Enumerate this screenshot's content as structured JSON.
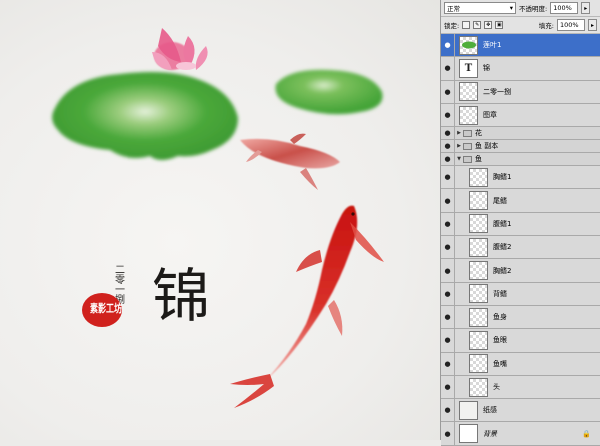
{
  "panel": {
    "blend_mode": "正常",
    "opacity_label": "不透明度:",
    "opacity_value": "100%",
    "lock_label": "锁定:",
    "fill_label": "填充:",
    "fill_value": "100%"
  },
  "layers": [
    {
      "name": "莲叶1",
      "type": "layer",
      "thumb": "leaf",
      "selected": true
    },
    {
      "name": "锦",
      "type": "text",
      "thumb": "T"
    },
    {
      "name": "二零一捌",
      "type": "layer",
      "thumb": "checker"
    },
    {
      "name": "图章",
      "type": "layer",
      "thumb": "checker"
    },
    {
      "name": "花",
      "type": "group",
      "expanded": false
    },
    {
      "name": "鱼 副本",
      "type": "group",
      "expanded": false
    },
    {
      "name": "鱼",
      "type": "group",
      "expanded": true
    },
    {
      "name": "胸鳍1",
      "type": "layer",
      "indent": true
    },
    {
      "name": "尾鳍",
      "type": "layer",
      "indent": true
    },
    {
      "name": "腹鳍1",
      "type": "layer",
      "indent": true
    },
    {
      "name": "腹鳍2",
      "type": "layer",
      "indent": true
    },
    {
      "name": "胸鳍2",
      "type": "layer",
      "indent": true
    },
    {
      "name": "背鳍",
      "type": "layer",
      "indent": true
    },
    {
      "name": "鱼身",
      "type": "layer",
      "indent": true
    },
    {
      "name": "鱼眼",
      "type": "layer",
      "indent": true
    },
    {
      "name": "鱼嘴",
      "type": "layer",
      "indent": true
    },
    {
      "name": "头",
      "type": "layer",
      "indent": true
    },
    {
      "name": "纸感",
      "type": "layer",
      "thumb": "plain"
    },
    {
      "name": "背景",
      "type": "background",
      "thumb": "white",
      "locked": true
    }
  ],
  "artwork": {
    "title_char": "锦",
    "year_text": "二零一捌",
    "seal_text": "素影工坊",
    "colors": {
      "leaf": "#4fae3b",
      "lotus": "#e9628c",
      "koi": "#d0201c",
      "seal": "#d0211d",
      "selection": "#3d6fc9"
    }
  }
}
